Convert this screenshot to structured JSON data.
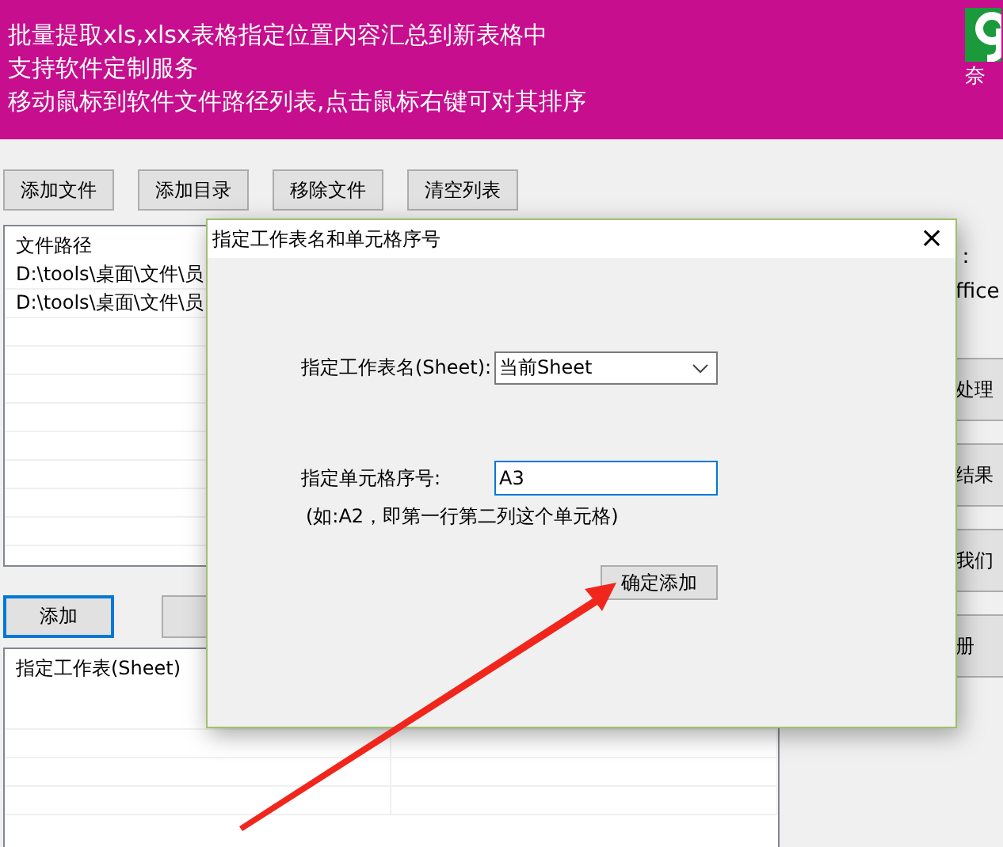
{
  "header": {
    "lines": [
      "批量提取xls,xlsx表格指定位置内容汇总到新表格中",
      "支持软件定制服务",
      "移动鼠标到软件文件路径列表,点击鼠标右键可对其排序"
    ],
    "logo_caption": "奈"
  },
  "toolbar": [
    "添加文件",
    "添加目录",
    "移除文件",
    "清空列表"
  ],
  "file_list": {
    "columns": [
      "文件路径"
    ],
    "rows": [
      "D:\\tools\\桌面\\文件\\员",
      "D:\\tools\\桌面\\文件\\员"
    ]
  },
  "side": {
    "texts": [
      "：",
      "ffice"
    ],
    "buttons": [
      "处理",
      "结果",
      "我们",
      "册"
    ]
  },
  "bottom_buttons": [
    {
      "label": "添加",
      "selected": true
    },
    {
      "selected": false
    }
  ],
  "sheet_list": {
    "columns": [
      "指定工作表(Sheet)"
    ]
  },
  "dialog": {
    "title": "指定工作表名和单元格序号",
    "close": "×",
    "sheet_label": "指定工作表名(Sheet):",
    "sheet_value": "当前Sheet",
    "cell_label": "指定单元格序号:",
    "cell_value": "A3",
    "hint": "(如:A2，即第一行第二列这个单元格)",
    "confirm": "确定添加"
  }
}
